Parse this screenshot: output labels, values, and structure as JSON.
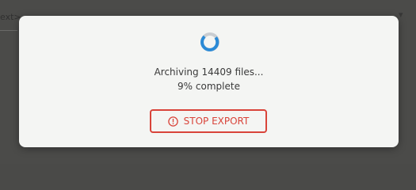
{
  "background": {
    "partial_text": "ext>",
    "chevron": "▾"
  },
  "dialog": {
    "spinner_icon": "circular-progress-icon",
    "status_text": "Archiving 14409 files...",
    "progress_text": "9% complete",
    "stop_button_label": "STOP EXPORT",
    "stop_button_icon": "alert-circle-icon"
  },
  "colors": {
    "accent": "#2b8ad6",
    "danger": "#d9443a",
    "dialog_bg": "#f4f5f3",
    "overlay": "#4b4b49"
  }
}
